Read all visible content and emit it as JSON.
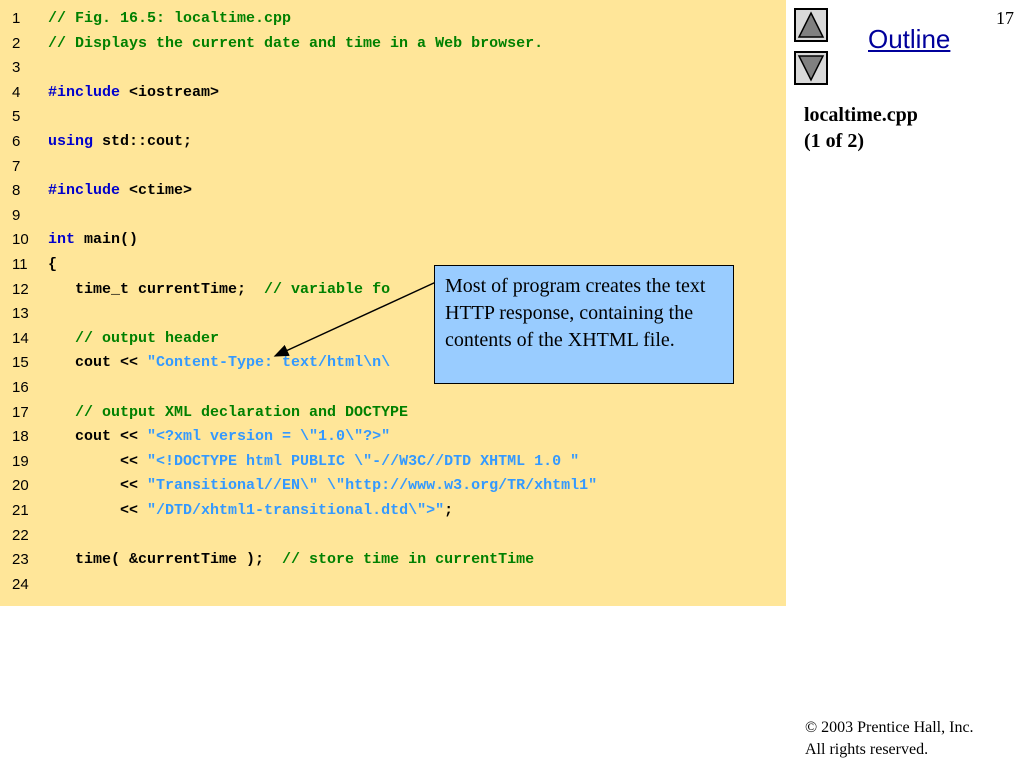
{
  "slide": {
    "number": "17",
    "outline_label": "Outline",
    "file_title": "localtime.cpp",
    "file_part": "(1 of 2)",
    "copyright_line1": "2003 Prentice Hall, Inc.",
    "copyright_line2": "All rights reserved.",
    "copyright_symbol": "©"
  },
  "callout": {
    "text": "Most of program creates the text HTTP response, containing the contents of the XHTML file."
  },
  "colors": {
    "code_bg": "#ffe699",
    "comment": "#008000",
    "keyword": "#0000cc",
    "string": "#3399ff",
    "callout_bg": "#99ccff"
  },
  "icons": {
    "prev": "triangle-up-icon",
    "next": "triangle-down-icon"
  },
  "code": {
    "lines": [
      {
        "n": "1",
        "tokens": [
          {
            "t": "comment",
            "v": "// Fig. 16.5: localtime.cpp"
          }
        ]
      },
      {
        "n": "2",
        "tokens": [
          {
            "t": "comment",
            "v": "// Displays the current date and time in a Web browser."
          }
        ]
      },
      {
        "n": "3",
        "tokens": []
      },
      {
        "n": "4",
        "tokens": [
          {
            "t": "keyword",
            "v": "#include"
          },
          {
            "t": "plain",
            "v": " <iostream>"
          }
        ]
      },
      {
        "n": "5",
        "tokens": []
      },
      {
        "n": "6",
        "tokens": [
          {
            "t": "keyword",
            "v": "using"
          },
          {
            "t": "plain",
            "v": " std::cout;"
          }
        ]
      },
      {
        "n": "7",
        "tokens": []
      },
      {
        "n": "8",
        "tokens": [
          {
            "t": "keyword",
            "v": "#include"
          },
          {
            "t": "plain",
            "v": " <ctime>"
          }
        ]
      },
      {
        "n": "9",
        "tokens": []
      },
      {
        "n": "10",
        "tokens": [
          {
            "t": "keyword",
            "v": "int"
          },
          {
            "t": "plain",
            "v": " main()"
          }
        ]
      },
      {
        "n": "11",
        "tokens": [
          {
            "t": "plain",
            "v": "{"
          }
        ]
      },
      {
        "n": "12",
        "tokens": [
          {
            "t": "plain",
            "v": "   time_t currentTime;  "
          },
          {
            "t": "comment",
            "v": "// variable fo"
          }
        ]
      },
      {
        "n": "13",
        "tokens": []
      },
      {
        "n": "14",
        "tokens": [
          {
            "t": "comment",
            "v": "   // output header"
          }
        ]
      },
      {
        "n": "15",
        "tokens": [
          {
            "t": "plain",
            "v": "   cout << "
          },
          {
            "t": "string",
            "v": "\"Content-Type: text/html\\n\\"
          }
        ]
      },
      {
        "n": "16",
        "tokens": []
      },
      {
        "n": "17",
        "tokens": [
          {
            "t": "comment",
            "v": "   // output XML declaration and DOCTYPE"
          }
        ]
      },
      {
        "n": "18",
        "tokens": [
          {
            "t": "plain",
            "v": "   cout << "
          },
          {
            "t": "string",
            "v": "\"<?xml version = \\\"1.0\\\"?>\""
          }
        ]
      },
      {
        "n": "19",
        "tokens": [
          {
            "t": "plain",
            "v": "        << "
          },
          {
            "t": "string",
            "v": "\"<!DOCTYPE html PUBLIC \\\"-//W3C//DTD XHTML 1.0 \""
          }
        ]
      },
      {
        "n": "20",
        "tokens": [
          {
            "t": "plain",
            "v": "        << "
          },
          {
            "t": "string",
            "v": "\"Transitional//EN\\\" \\\"http://www.w3.org/TR/xhtml1\""
          }
        ]
      },
      {
        "n": "21",
        "tokens": [
          {
            "t": "plain",
            "v": "        << "
          },
          {
            "t": "string",
            "v": "\"/DTD/xhtml1-transitional.dtd\\\">\""
          },
          {
            "t": "plain",
            "v": ";"
          }
        ]
      },
      {
        "n": "22",
        "tokens": []
      },
      {
        "n": "23",
        "tokens": [
          {
            "t": "plain",
            "v": "   time( &currentTime );  "
          },
          {
            "t": "comment",
            "v": "// store time in currentTime"
          }
        ]
      },
      {
        "n": "24",
        "tokens": []
      }
    ]
  }
}
